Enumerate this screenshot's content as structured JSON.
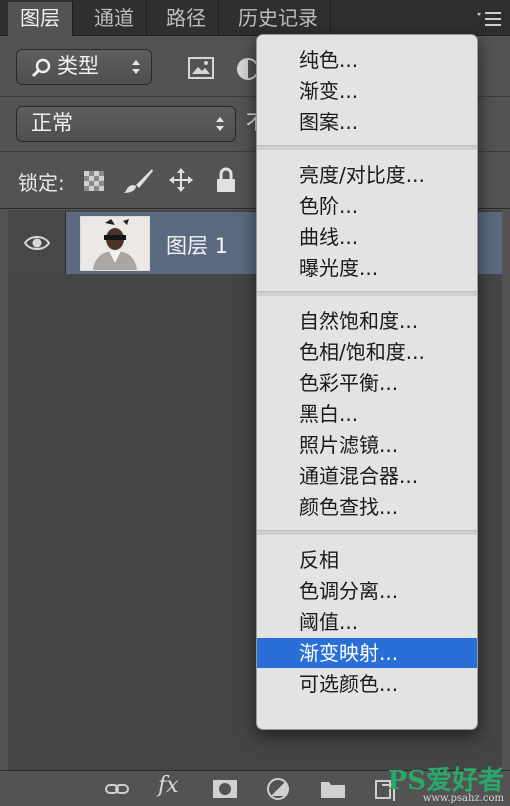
{
  "tabs": [
    {
      "label": "图层",
      "active": true
    },
    {
      "label": "通道",
      "active": false
    },
    {
      "label": "路径",
      "active": false
    },
    {
      "label": "历史记录",
      "active": false
    }
  ],
  "filter": {
    "icon": "search-icon",
    "value": "类型"
  },
  "blend_mode": {
    "value": "正常",
    "opacity_label_partial": "不"
  },
  "lock": {
    "label": "锁定:"
  },
  "layer": {
    "name": "图层 1"
  },
  "menu": {
    "groups": [
      [
        "纯色...",
        "渐变...",
        "图案..."
      ],
      [
        "亮度/对比度...",
        "色阶...",
        "曲线...",
        "曝光度..."
      ],
      [
        "自然饱和度...",
        "色相/饱和度...",
        "色彩平衡...",
        "黑白...",
        "照片滤镜...",
        "通道混合器...",
        "颜色查找..."
      ],
      [
        "反相",
        "色调分离...",
        "阈值...",
        "渐变映射...",
        "可选颜色..."
      ]
    ],
    "selected": "渐变映射..."
  },
  "bottom_icons": [
    "link-icon",
    "fx-icon",
    "mask-icon",
    "adjustment-icon",
    "folder-icon",
    "new-layer-icon"
  ],
  "fx_label": "fx",
  "watermark": {
    "main": "PS爱好者",
    "sub": "www.psahz.com"
  },
  "colors": {
    "panel": "#535353",
    "selected_layer": "#5b6a81",
    "menu_highlight": "#2a6fd8",
    "menu_bg": "#e3e3e3"
  }
}
